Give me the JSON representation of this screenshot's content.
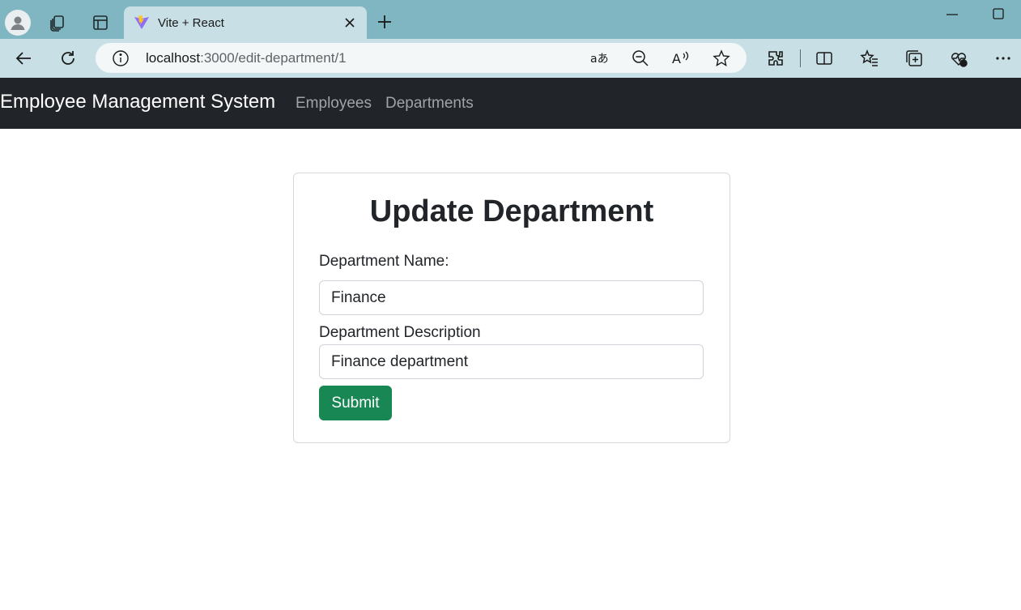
{
  "browser": {
    "tab_title": "Vite + React",
    "url_host": "localhost",
    "url_path": ":3000/edit-department/1",
    "icons": [
      "profile-icon",
      "workspaces-icon",
      "tab-actions-icon",
      "vite-favicon-icon",
      "close-icon",
      "new-tab-icon",
      "minimize-icon",
      "maximize-icon",
      "back-icon",
      "refresh-icon",
      "site-info-icon",
      "translate-icon",
      "zoom-out-icon",
      "read-aloud-icon",
      "favorite-star-icon",
      "extensions-icon",
      "split-screen-icon",
      "favorites-icon",
      "collections-icon",
      "browser-essentials-icon",
      "more-icon"
    ],
    "colors": {
      "tabbar": "#7fb6c1",
      "toolbar": "#c8e0e5"
    }
  },
  "navbar": {
    "brand": "Employee Management System",
    "links": [
      "Employees",
      "Departments"
    ],
    "colors": {
      "background": "#212529",
      "brand": "#ffffff",
      "link": "#9ea4aa"
    }
  },
  "form": {
    "title": "Update Department",
    "name_label": "Department Name:",
    "name_value": "Finance",
    "description_label": "Department Description",
    "description_value": "Finance department",
    "submit_label": "Submit",
    "colors": {
      "submit": "#198754"
    }
  }
}
